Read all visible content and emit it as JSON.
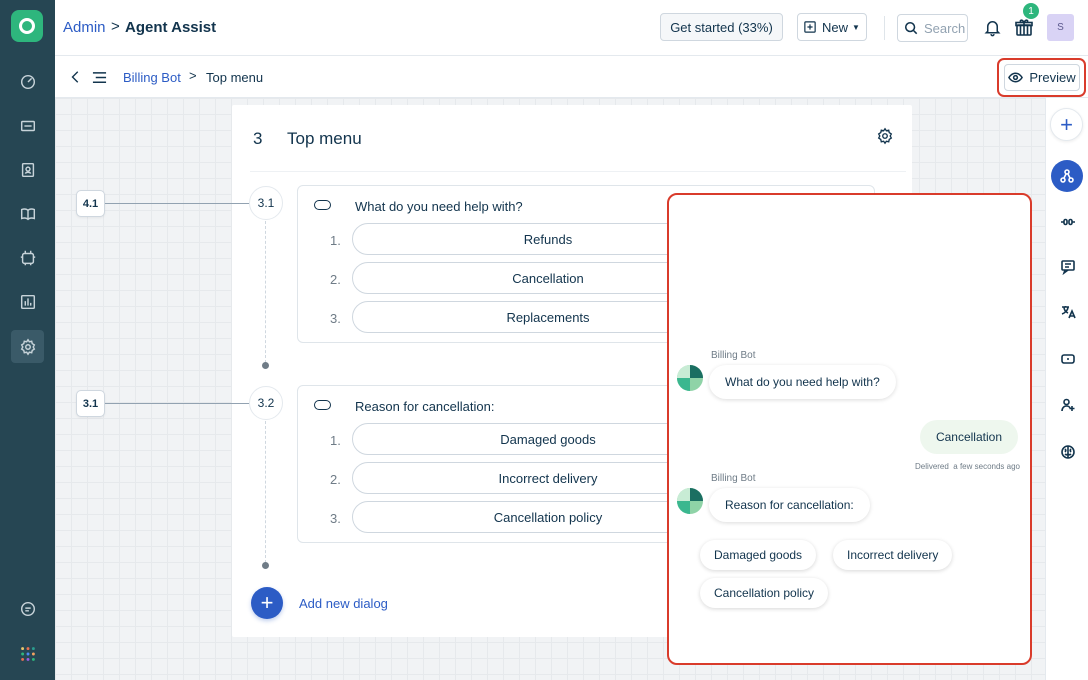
{
  "header": {
    "breadcrumb_admin": "Admin",
    "breadcrumb_separator": ">",
    "breadcrumb_current": "Agent Assist",
    "get_started_label": "Get started (33%)",
    "new_label": "New",
    "search_placeholder": "Search",
    "gift_badge": "1",
    "avatar_initial": "S"
  },
  "subbar": {
    "bot_name": "Billing Bot",
    "separator": ">",
    "current_page": "Top menu",
    "preview_label": "Preview"
  },
  "left_nav": {
    "icons": [
      "dashboard-icon",
      "tickets-icon",
      "contacts-icon",
      "knowledge-base-icon",
      "bots-icon",
      "reports-icon",
      "admin-settings-icon",
      "chat-icon",
      "apps-grid-icon"
    ],
    "active": "admin-settings-icon"
  },
  "right_rail": {
    "icons": [
      "add-icon",
      "flow-icon",
      "variables-icon",
      "message-icon",
      "translate-icon",
      "widget-icon",
      "handover-icon",
      "ai-brain-icon"
    ],
    "active": "flow-icon"
  },
  "flow": {
    "step_number": "3",
    "title": "Top menu",
    "dialogs": [
      {
        "incoming_tag": "4.1",
        "id": "3.1",
        "question": "What do you need help with?",
        "options": [
          {
            "n": "1.",
            "label": "Refunds"
          },
          {
            "n": "2.",
            "label": "Cancellation"
          },
          {
            "n": "3.",
            "label": "Replacements"
          }
        ]
      },
      {
        "incoming_tag": "3.1",
        "id": "3.2",
        "question": "Reason for cancellation:",
        "options": [
          {
            "n": "1.",
            "label": "Damaged goods"
          },
          {
            "n": "2.",
            "label": "Incorrect delivery"
          },
          {
            "n": "3.",
            "label": "Cancellation policy"
          }
        ]
      }
    ],
    "add_dialog_label": "Add new dialog"
  },
  "chat_preview": {
    "messages": [
      {
        "sender": "Billing Bot",
        "text": "What do you need help with?"
      },
      {
        "user_text": "Cancellation",
        "status": "Delivered",
        "time": "a few seconds ago"
      },
      {
        "sender": "Billing Bot",
        "text": "Reason for cancellation:"
      }
    ],
    "quick_replies": [
      "Damaged goods",
      "Incorrect delivery",
      "Cancellation policy"
    ]
  },
  "colors": {
    "nav_bg": "#264653",
    "accent_blue": "#2c5cc5",
    "brand_green": "#2eb67d",
    "highlight_red": "#d93b2b"
  }
}
